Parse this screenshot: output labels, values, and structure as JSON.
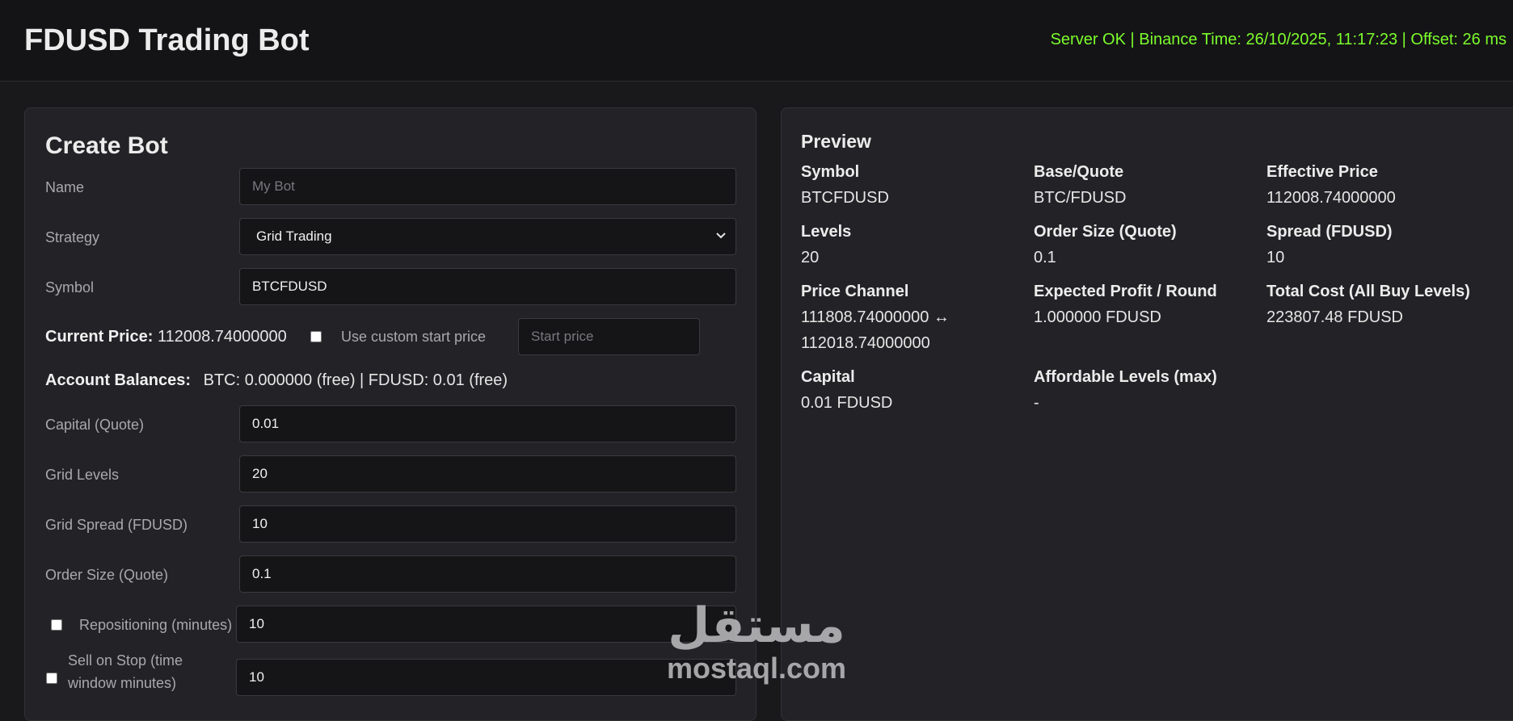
{
  "header": {
    "title": "FDUSD Trading Bot",
    "status": "Server OK | Binance Time: 26/10/2025, 11:17:23 | Offset: 26 ms"
  },
  "create": {
    "title": "Create Bot",
    "name": {
      "label": "Name",
      "value": "",
      "placeholder": "My Bot"
    },
    "strategy": {
      "label": "Strategy",
      "value": "Grid Trading"
    },
    "symbol": {
      "label": "Symbol",
      "value": "BTCFDUSD"
    },
    "current_price": {
      "label": "Current Price:",
      "value": "112008.74000000",
      "custom_label": "Use custom start price",
      "custom_placeholder": "Start price"
    },
    "balances": {
      "label": "Account Balances:",
      "value": "BTC: 0.000000 (free) | FDUSD: 0.01 (free)"
    },
    "capital": {
      "label": "Capital (Quote)",
      "value": "0.01"
    },
    "grid_levels": {
      "label": "Grid Levels",
      "value": "20"
    },
    "grid_spread": {
      "label": "Grid Spread (FDUSD)",
      "value": "10"
    },
    "order_size": {
      "label": "Order Size (Quote)",
      "value": "0.1"
    },
    "repositioning": {
      "label": "Repositioning (minutes)",
      "value": "10"
    },
    "sell_on_stop": {
      "label_line1": "Sell on Stop (time",
      "label_line2": "window minutes)",
      "value": "10"
    }
  },
  "preview": {
    "title": "Preview",
    "items": [
      {
        "label": "Symbol",
        "value": "BTCFDUSD"
      },
      {
        "label": "Base/Quote",
        "value": "BTC/FDUSD"
      },
      {
        "label": "Effective Price",
        "value": "112008.74000000"
      },
      {
        "label": "Levels",
        "value": "20"
      },
      {
        "label": "Order Size (Quote)",
        "value": "0.1"
      },
      {
        "label": "Spread (FDUSD)",
        "value": "10"
      },
      {
        "label": "Price Channel",
        "value": "111808.74000000 ↔",
        "value2": "112018.74000000"
      },
      {
        "label": "Expected Profit / Round",
        "value": "1.000000 FDUSD"
      },
      {
        "label": "Total Cost (All Buy Levels)",
        "value": "223807.48 FDUSD"
      },
      {
        "label": "Capital",
        "value": "0.01 FDUSD"
      },
      {
        "label": "Affordable Levels (max)",
        "value": "-"
      }
    ]
  },
  "watermark": {
    "arabic": "مستقل",
    "latin": "mostaql.com"
  }
}
